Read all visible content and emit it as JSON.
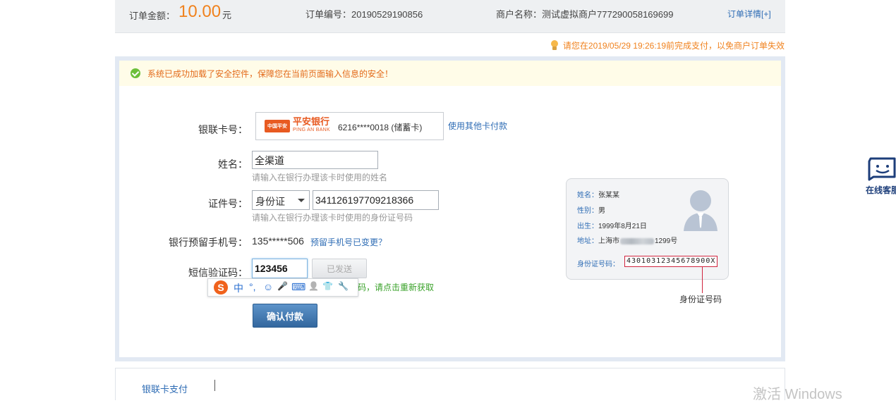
{
  "order": {
    "amount_label": "订单金额：",
    "amount_value": "10.00",
    "amount_unit": "元",
    "order_no": "订单编号：20190529190856",
    "merchant": "商户名称：测试虚拟商户777290058169699",
    "detail_link": "订单详情[+]"
  },
  "deadline_notice": "请您在2019/05/29 19:26:19前完成支付，以免商户订单失效",
  "security_message": "系统已成功加载了安全控件，保障您在当前页面输入信息的安全！",
  "form": {
    "card_label": "银联卡号：",
    "bank_name": "平安银行",
    "bank_name_en": "PING AN BANK",
    "bank_badge": "中国平安",
    "card_number": "6216****0018 (储蓄卡)",
    "other_card_link": "使用其他卡付款",
    "name_label": "姓名：",
    "name_value": "全渠道",
    "name_hint": "请输入在银行办理该卡时使用的姓名",
    "id_label": "证件号：",
    "id_type": "身份证",
    "id_value": "341126197709218366",
    "id_hint": "请输入在银行办理该卡时使用的身份证号码",
    "phone_label": "银行预留手机号：",
    "phone_value": "135*****506",
    "phone_changed_link": "预留手机号已变更？",
    "sms_label": "短信验证码：",
    "sms_value": "123456",
    "sent_button": "已发送",
    "resend_hint": "码，请点击重新获取",
    "confirm_button": "确认付款"
  },
  "ime": {
    "logo": "S",
    "items": [
      "中",
      "°,",
      "☺",
      "🎤",
      "⌨",
      "👤",
      "👕",
      "🔧"
    ]
  },
  "id_card": {
    "name_key": "姓名：",
    "name_val": "张某某",
    "gender_key": "性别：",
    "gender_val": "男",
    "birth_key": "出生：",
    "birth_val": "1999年8月21日",
    "address_key": "地址：",
    "address_prefix": "上海市",
    "address_suffix": "1299号",
    "number_key": "身份证号码：",
    "number_val": "43010312345678900X",
    "callout": "身份证号码"
  },
  "footer": {
    "tab_label": "银联卡支付"
  },
  "service": {
    "label": "在线客服"
  },
  "watermark": "激活 Windows",
  "colors": {
    "accent_orange": "#f0821e",
    "link_blue": "#2f6db5",
    "button_blue": "#33679e",
    "highlight_red": "#d0243e"
  }
}
